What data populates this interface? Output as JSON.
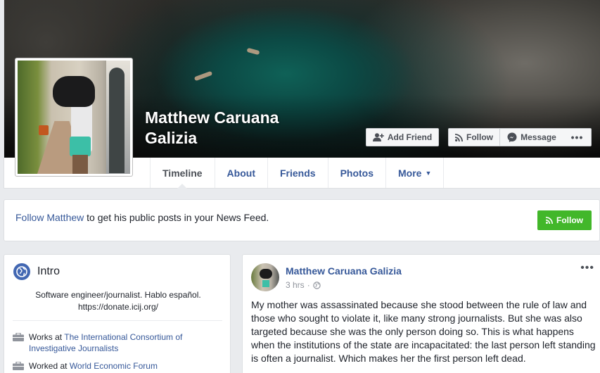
{
  "profile": {
    "name_line1": "Matthew Caruana",
    "name_line2": "Galizia"
  },
  "actions": {
    "add_friend": "Add Friend",
    "follow": "Follow",
    "message": "Message",
    "more": "•••"
  },
  "tabs": [
    {
      "label": "Timeline",
      "active": true
    },
    {
      "label": "About"
    },
    {
      "label": "Friends"
    },
    {
      "label": "Photos"
    },
    {
      "label": "More"
    }
  ],
  "follow_bar": {
    "link": "Follow Matthew",
    "text": " to get his public posts in your News Feed.",
    "button": "Follow"
  },
  "intro": {
    "title": "Intro",
    "bio_line1": "Software engineer/journalist. Hablo español.",
    "bio_line2": "https://donate.icij.org/",
    "work": [
      {
        "prefix": "Works at ",
        "org": "The International Consortium of Investigative Journalists"
      },
      {
        "prefix": "Worked at ",
        "org": "World Economic Forum"
      }
    ]
  },
  "post": {
    "author": "Matthew Caruana Galizia",
    "time": "3 hrs",
    "more": "•••",
    "text": "My mother was assassinated because she stood between the rule of law and those who sought to violate it, like many strong journalists. But she was also targeted because she was the only person doing so. This is what happens when the institutions of the state are incapacitated: the last person left standing is often a journalist. Which makes her the first person left dead."
  },
  "colors": {
    "link": "#365899",
    "follow_green": "#42b72a",
    "page_bg": "#e9ebee"
  }
}
